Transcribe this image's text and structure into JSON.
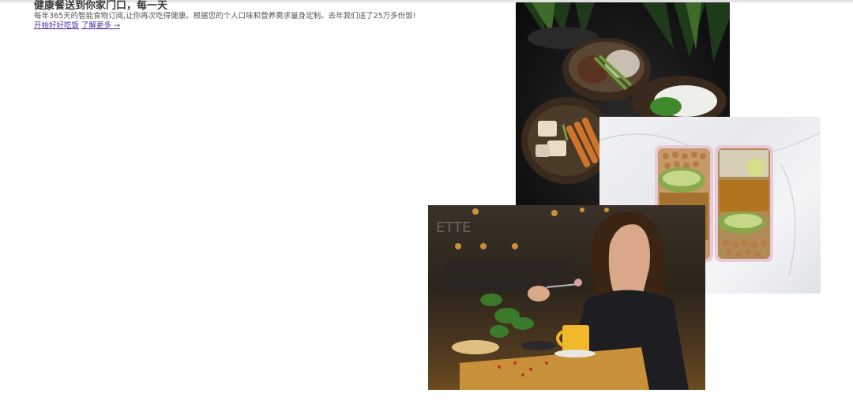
{
  "hero": {
    "title": "健康餐送到你家门口，每一天",
    "subtitle": "每年365天的智能食物订阅,让你再次吃得健康。根据您的个人口味和营养需求量身定制。去年我们送了25万多份饭!",
    "cta_primary": "开始好好吃饭",
    "cta_secondary": "了解更多 →"
  },
  "images": {
    "bowls": "bowls-of-food-photo",
    "mealprep": "meal-prep-boxes-photo",
    "cafe": "woman-eating-in-cafe-photo"
  }
}
